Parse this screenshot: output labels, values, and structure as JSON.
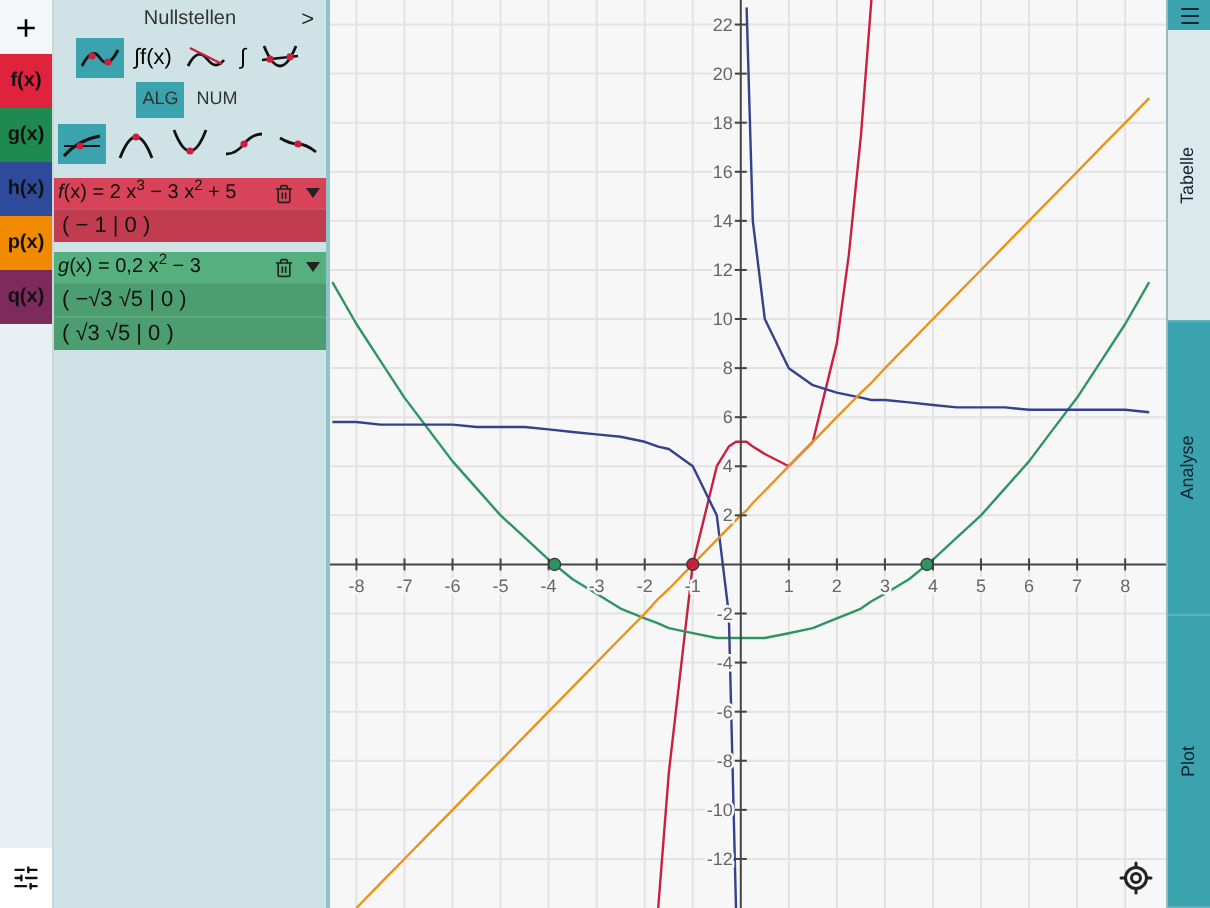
{
  "add_button": {
    "label": "+"
  },
  "functions": [
    {
      "label": "f(x)",
      "color": "#e0233c"
    },
    {
      "label": "g(x)",
      "color": "#1f8a4f"
    },
    {
      "label": "h(x)",
      "color": "#2e4b9b"
    },
    {
      "label": "p(x)",
      "color": "#f28a00"
    },
    {
      "label": "q(x)",
      "color": "#7c2b5c"
    }
  ],
  "analysis_panel": {
    "title": "Nullstellen",
    "next": ">",
    "tools": [
      {
        "kind": "zeros",
        "selected": true
      },
      {
        "kind": "antiderivative",
        "label": "∫f(x)",
        "selected": false
      },
      {
        "kind": "tangent",
        "selected": false
      },
      {
        "kind": "integral",
        "label": "∫",
        "selected": false
      },
      {
        "kind": "intersection",
        "selected": false
      }
    ],
    "modes": [
      {
        "label": "ALG",
        "selected": true
      },
      {
        "label": "NUM",
        "selected": false
      }
    ],
    "point_types": [
      {
        "kind": "root",
        "selected": true
      },
      {
        "kind": "maximum",
        "selected": false
      },
      {
        "kind": "minimum",
        "selected": false
      },
      {
        "kind": "inflection",
        "selected": false
      },
      {
        "kind": "saddle",
        "selected": false
      }
    ],
    "entries": [
      {
        "formula": "*f*(x) = 2 x$^{3}$ − 3 x$^{2}$ + 5",
        "color": "#d9435a",
        "results": [
          "( − 1 | 0 )"
        ]
      },
      {
        "formula": "*g*(x) = 0,2 x$^{2}$ − 3",
        "color": "#55b07d",
        "results": [
          "( −√3 √5 | 0 )",
          "( √3 √5 | 0 )"
        ]
      }
    ]
  },
  "graph": {
    "chart_data": {
      "type": "line",
      "grid": true,
      "xlim": [
        -8.55,
        8.85
      ],
      "ylim": [
        -14,
        23
      ],
      "xticks": [
        -8,
        -7,
        -6,
        -5,
        -4,
        -3,
        -2,
        -1,
        1,
        2,
        3,
        4,
        5,
        6,
        7,
        8
      ],
      "yticks": [
        -12,
        -10,
        -8,
        -6,
        -4,
        -2,
        2,
        4,
        6,
        8,
        10,
        12,
        14,
        16,
        18,
        20,
        22
      ],
      "x": [
        -8.5,
        -8,
        -7.5,
        -7,
        -6.5,
        -6,
        -5.5,
        -5,
        -4.5,
        -4,
        -3.5,
        -3,
        -2.5,
        -2,
        -1.72,
        -1.5,
        -1,
        -0.5,
        -0.25,
        -0.1,
        0,
        0.12,
        0.25,
        0.5,
        1,
        1.5,
        2,
        2.25,
        2.5,
        2.72,
        3,
        3.5,
        4,
        4.5,
        5,
        5.5,
        6,
        6.5,
        7,
        7.5,
        8,
        8.5
      ],
      "series": [
        {
          "color": "#c8203f",
          "values": [
            null,
            null,
            null,
            null,
            null,
            null,
            null,
            null,
            null,
            null,
            null,
            null,
            null,
            null,
            -14,
            -8.5,
            0,
            4,
            4.8,
            5,
            5,
            5,
            4.8,
            4.5,
            4,
            5,
            9,
            12.6,
            17.5,
            23,
            null,
            null,
            null,
            null,
            null,
            null,
            null,
            null,
            null,
            null,
            null,
            null
          ]
        },
        {
          "color": "#2e9460",
          "values": [
            11.5,
            9.8,
            8.3,
            6.8,
            5.5,
            4.2,
            3.1,
            2,
            1.1,
            0.2,
            -0.6,
            -1.2,
            -1.8,
            -2.2,
            -2.4,
            -2.6,
            -2.8,
            -3,
            -3,
            -3,
            -3,
            -3,
            -3,
            -3,
            -2.8,
            -2.6,
            -2.2,
            -2,
            -1.8,
            -1.5,
            -1.2,
            -0.6,
            0.2,
            1.1,
            2,
            3.1,
            4.2,
            5.5,
            6.8,
            8.3,
            9.8,
            11.5
          ]
        },
        {
          "color": "#34418c",
          "values": [
            5.8,
            5.8,
            5.7,
            5.7,
            5.7,
            5.7,
            5.6,
            5.6,
            5.6,
            5.5,
            5.4,
            5.3,
            5.2,
            5,
            4.8,
            4.7,
            4,
            2,
            -2,
            -14,
            null,
            22.7,
            14,
            10,
            8,
            7.3,
            7,
            6.9,
            6.8,
            6.7,
            6.7,
            6.6,
            6.5,
            6.4,
            6.4,
            6.4,
            6.3,
            6.3,
            6.3,
            6.3,
            6.3,
            6.2
          ]
        },
        {
          "color": "#e8941a",
          "values": [
            null,
            -14,
            -13,
            -12,
            -11,
            -10,
            -9,
            -8,
            -7,
            -6,
            -5,
            -4,
            -3,
            -2,
            -1.4,
            -1,
            0,
            1,
            1.5,
            1.8,
            2,
            2.2,
            2.5,
            3,
            4,
            5,
            6,
            6.5,
            7,
            7.4,
            8,
            9,
            10,
            11,
            12,
            13,
            14,
            15,
            16,
            17,
            18,
            19
          ]
        }
      ]
    }
  },
  "side_tabs": [
    {
      "label": "Tabelle",
      "selected": true
    },
    {
      "label": "Analyse",
      "selected": false
    },
    {
      "label": "Plot",
      "selected": false
    }
  ]
}
